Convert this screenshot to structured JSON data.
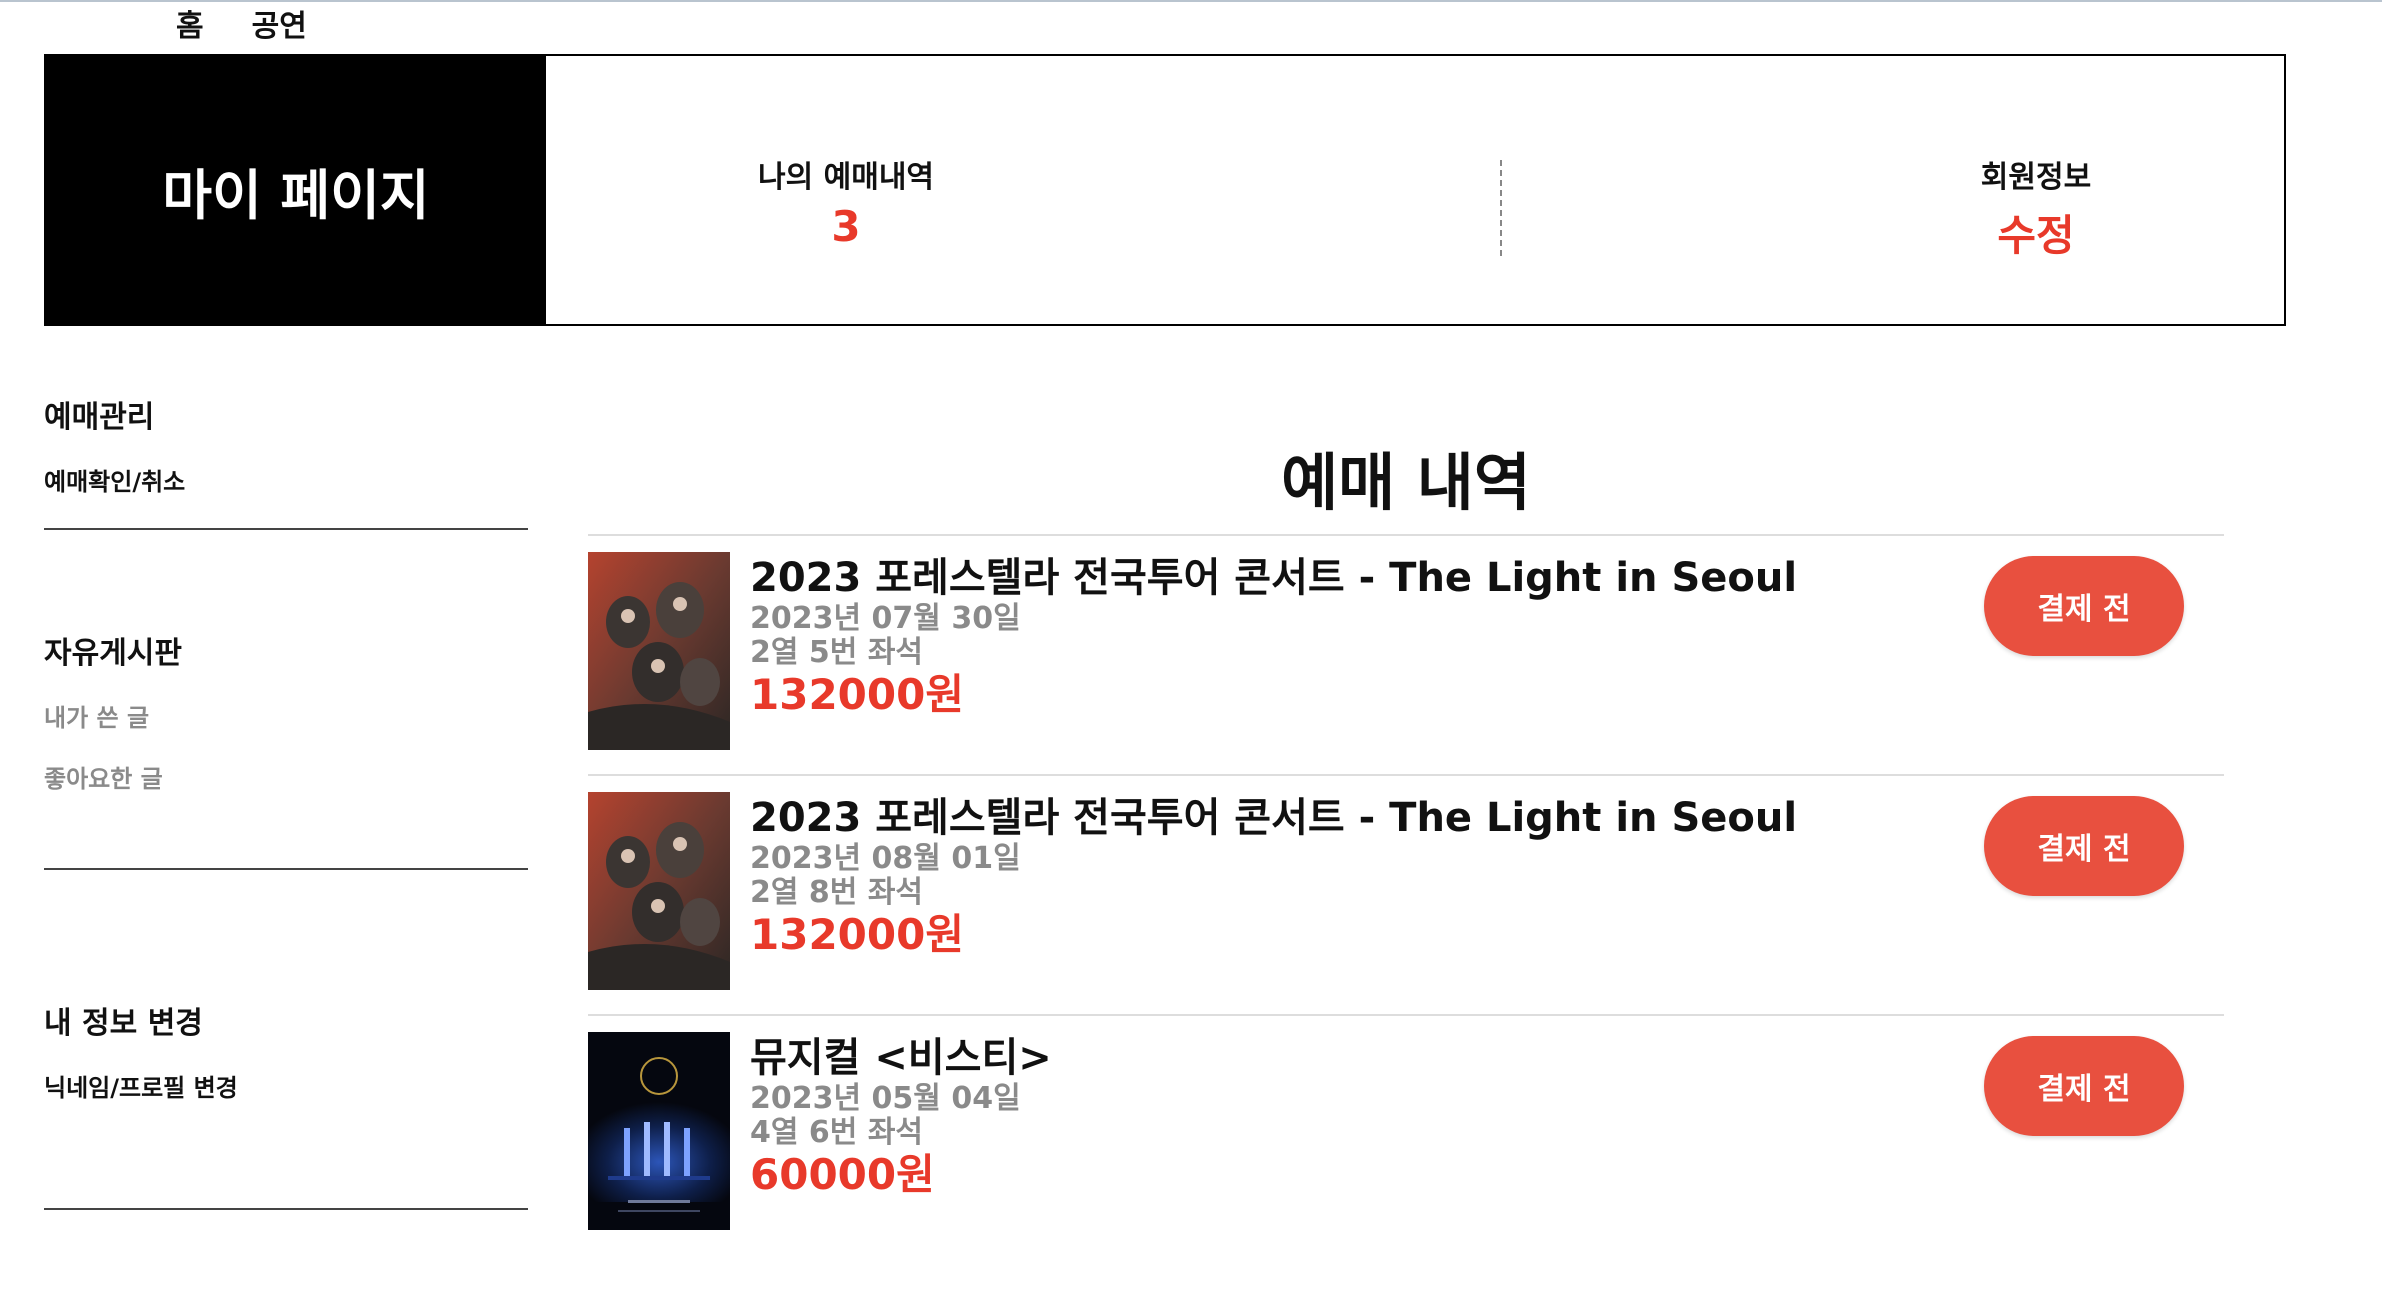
{
  "nav": {
    "home": "홈",
    "performances": "공연"
  },
  "mypage": {
    "title": "마이 페이지",
    "bookings_label": "나의 예매내역",
    "bookings_count": "3",
    "member_label": "회원정보",
    "member_action": "수정"
  },
  "sidebar": {
    "section1": {
      "title": "예매관리",
      "links": [
        "예매확인/취소"
      ]
    },
    "section2": {
      "title": "자유게시판",
      "links": [
        "내가 쓴 글",
        "좋아요한 글"
      ]
    },
    "section3": {
      "title": "내 정보 변경",
      "links": [
        "닉네임/프로필 변경"
      ]
    }
  },
  "main": {
    "title": "예매 내역",
    "bookings": [
      {
        "title": "2023 포레스텔라 전국투어 콘서트 - The Light in Seoul",
        "date": "2023년 07월 30일",
        "seat": "2열 5번 좌석",
        "price": "132000원",
        "button": "결제 전"
      },
      {
        "title": "2023 포레스텔라 전국투어 콘서트 - The Light in Seoul",
        "date": "2023년 08월 01일",
        "seat": "2열 8번 좌석",
        "price": "132000원",
        "button": "결제 전"
      },
      {
        "title": "뮤지컬 <비스티>",
        "date": "2023년 05월 04일",
        "seat": "4열 6번 좌석",
        "price": "60000원",
        "button": "결제 전"
      }
    ]
  },
  "colors": {
    "accent": "#e8392a",
    "button_bg": "#e8503f",
    "muted": "#8a8a8a"
  }
}
